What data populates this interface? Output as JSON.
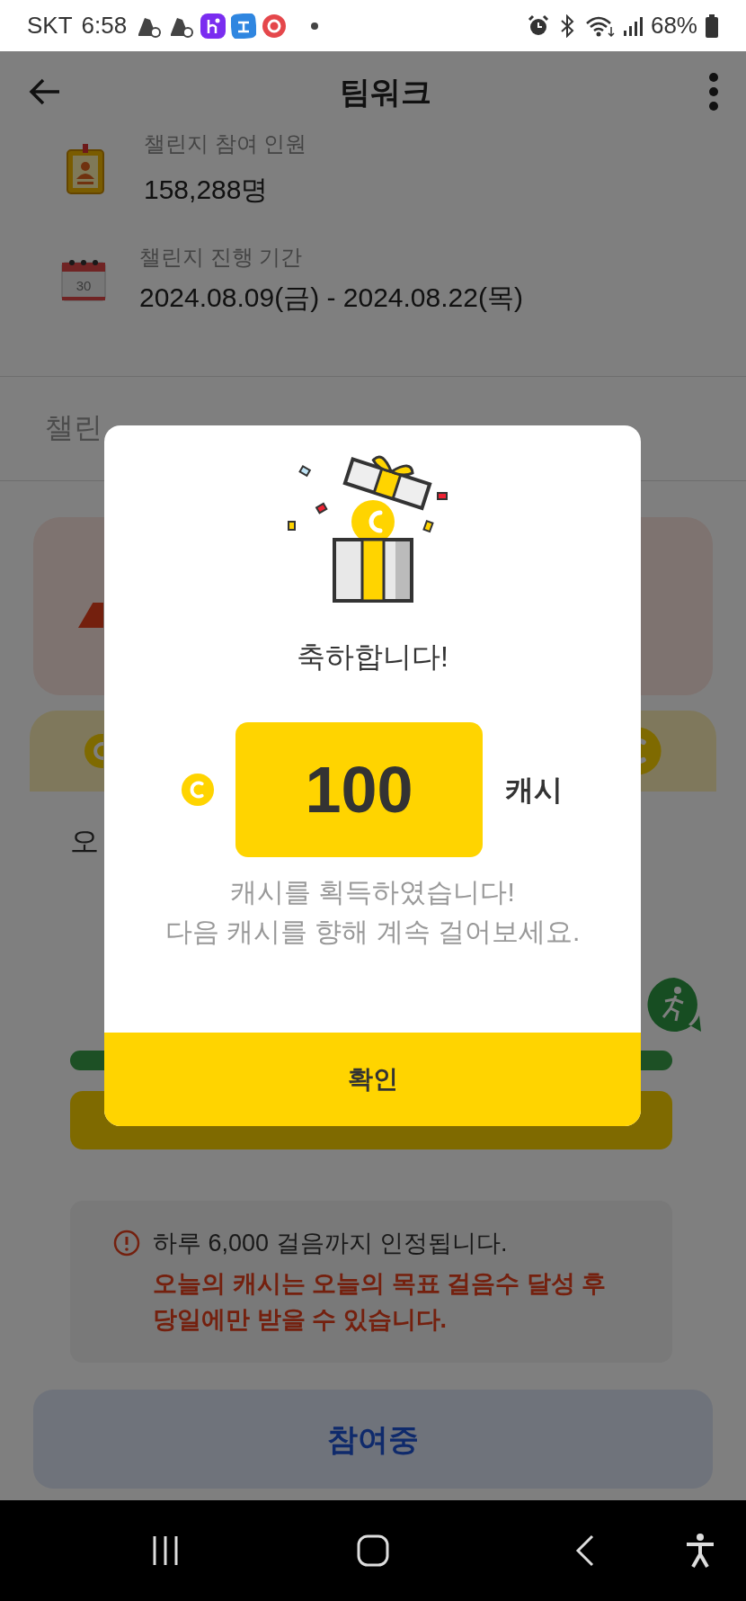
{
  "status_bar": {
    "carrier": "SKT",
    "time": "6:58",
    "battery": "68%"
  },
  "header": {
    "title": "팀워크"
  },
  "info": [
    {
      "kind": "badge",
      "label": "챌린지 참여 인원",
      "value": "158,288명"
    },
    {
      "kind": "calendar",
      "label": "챌린지 진행 기간",
      "value": "2024.08.09(금) - 2024.08.22(목)",
      "icon_text": "30"
    }
  ],
  "tabs": [
    {
      "label": "챌린",
      "selected": false
    }
  ],
  "reward_card": {
    "title": "오",
    "notice": {
      "text": "하루 6,000 걸음까지 인정됩니다.",
      "warning": "오늘의 캐시는 오늘의 목표 걸음수 달성 후\n당일에만 받을 수 있습니다."
    }
  },
  "join_button": "참여중",
  "dialog": {
    "title": "축하합니다!",
    "amount": "100",
    "unit": "캐시",
    "message": "캐시를 획득하였습니다!\n다음 캐시를 향해 계속 걸어보세요.",
    "confirm": "확인"
  }
}
